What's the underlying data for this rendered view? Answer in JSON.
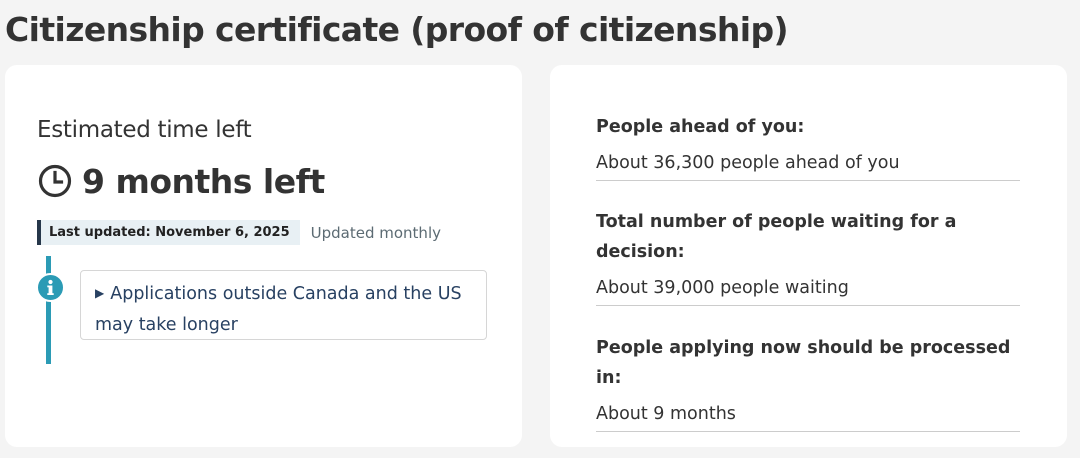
{
  "page": {
    "title": "Citizenship certificate (proof of citizenship)"
  },
  "estimate": {
    "label": "Estimated time left",
    "value": "9 months left",
    "icon": "clock-icon",
    "last_updated": "Last updated: November 6, 2025",
    "update_frequency": "Updated monthly",
    "details_summary": "Applications outside Canada and the US may take longer",
    "info_icon": "info-icon"
  },
  "stats": [
    {
      "label": "People ahead of you:",
      "value": "About 36,300 people ahead of you"
    },
    {
      "label": "Total number of people waiting for a decision:",
      "value": "About 39,000 people waiting"
    },
    {
      "label": "People applying now should be processed in:",
      "value": "About 9 months"
    }
  ],
  "colors": {
    "background": "#f4f4f4",
    "card": "#ffffff",
    "accent_info": "#2b9bb5",
    "link": "#284162",
    "label_border": "#26374a",
    "label_bg": "#e8f0f4"
  }
}
